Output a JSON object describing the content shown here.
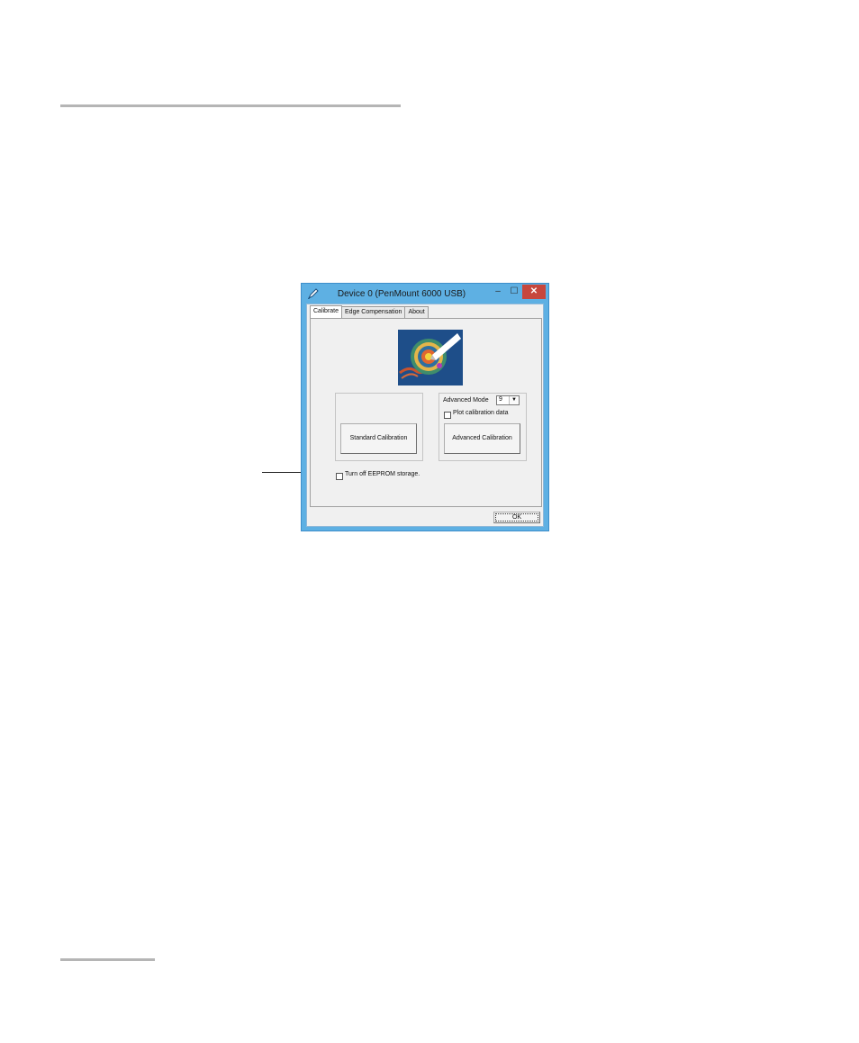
{
  "window": {
    "title": "Device 0 (PenMount 6000 USB)",
    "controls": {
      "minimize": "–",
      "maximize": "☐",
      "close": "✕"
    },
    "icons": {
      "app": "pen-icon",
      "target_image": "target-pen-icon"
    },
    "colors": {
      "frame": "#5eb0e3",
      "close": "#c7473d",
      "client": "#f0f0f0",
      "image_bg": "#1e4e89"
    }
  },
  "tabs": [
    {
      "label": "Calibrate",
      "active": true
    },
    {
      "label": "Edge Compensation",
      "active": false
    },
    {
      "label": "About",
      "active": false
    }
  ],
  "calibrate": {
    "standard_button": "Standard Calibration",
    "advanced_mode_label": "Advanced Mode",
    "advanced_mode_value": "9",
    "plot_checkbox_label": "Plot calibration data",
    "plot_checked": false,
    "advanced_button": "Advanced Calibration",
    "eeprom_checkbox_label": "Turn off EEPROM storage.",
    "eeprom_checked": false
  },
  "footer": {
    "ok_button": "OK"
  }
}
